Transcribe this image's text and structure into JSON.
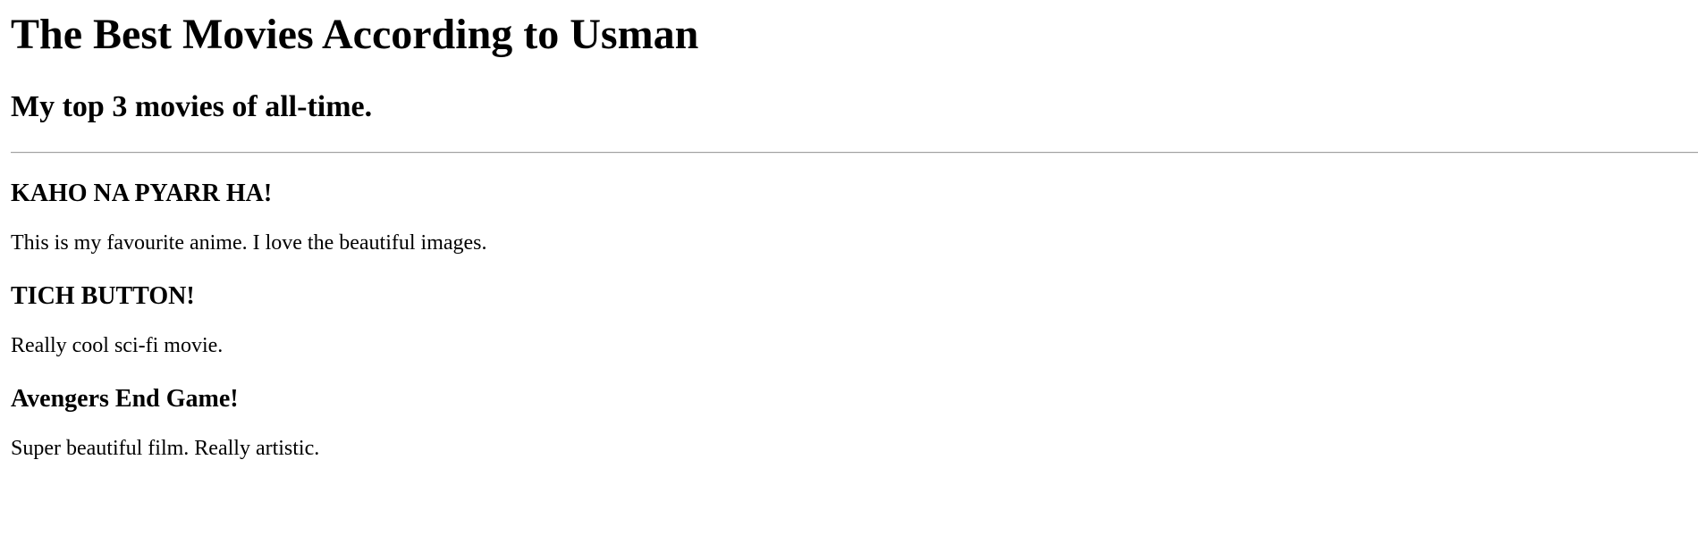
{
  "header": {
    "title": "The Best Movies According to Usman",
    "subtitle": "My top 3 movies of all-time."
  },
  "movies": [
    {
      "title": "KAHO NA PYARR HA!",
      "description": "This is my favourite anime. I love the beautiful images."
    },
    {
      "title": "TICH BUTTON!",
      "description": "Really cool sci-fi movie."
    },
    {
      "title": "Avengers End Game!",
      "description": "Super beautiful film. Really artistic."
    }
  ]
}
